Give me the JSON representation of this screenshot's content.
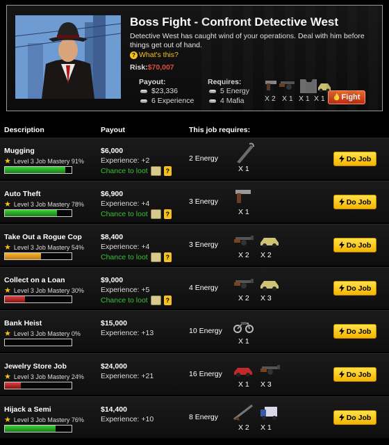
{
  "boss": {
    "title": "Boss Fight - Confront Detective West",
    "description": "Detective West has caught wind of your operations. Deal with him before things get out of hand.",
    "whats_this": "What's this?",
    "risk_label": "Risk:",
    "risk_value": "$70,007",
    "payout_header": "Payout:",
    "payout_money": "$23,336",
    "payout_experience": "6 Experience",
    "requires_header": "Requires:",
    "requires_energy": "5 Energy",
    "requires_mafia": "4 Mafia",
    "items": [
      {
        "icon": "pistol-icon",
        "qty": "X 2"
      },
      {
        "icon": "tommy-gun-icon",
        "qty": "X 1"
      },
      {
        "icon": "vest-icon",
        "qty": "X 1"
      },
      {
        "icon": "car-icon",
        "qty": "X 1"
      }
    ],
    "fight_label": "Fight"
  },
  "table_headers": {
    "description": "Description",
    "payout": "Payout",
    "requires": "This job requires:"
  },
  "jobs": [
    {
      "name": "Mugging",
      "mastery": "Level 3 Job Mastery 91%",
      "mastery_pct": 91,
      "bar_color": "green",
      "money": "$6,000",
      "experience": "Experience: +2",
      "loot": "Chance to loot",
      "energy": "2 Energy",
      "items": [
        {
          "icon": "crowbar-icon",
          "qty": "X 1"
        }
      ],
      "button": "Do Job"
    },
    {
      "name": "Auto Theft",
      "mastery": "Level 3 Job Mastery 78%",
      "mastery_pct": 78,
      "bar_color": "green",
      "money": "$6,900",
      "experience": "Experience: +4",
      "loot": "Chance to loot",
      "energy": "3 Energy",
      "items": [
        {
          "icon": "pistol-icon",
          "qty": "X 1"
        }
      ],
      "button": "Do Job"
    },
    {
      "name": "Take Out a Rogue Cop",
      "mastery": "Level 3 Job Mastery 54%",
      "mastery_pct": 54,
      "bar_color": "orange",
      "money": "$8,400",
      "experience": "Experience: +4",
      "loot": "Chance to loot",
      "energy": "3 Energy",
      "items": [
        {
          "icon": "tommy-gun-icon",
          "qty": "X 2"
        },
        {
          "icon": "car-icon",
          "qty": "X 2"
        }
      ],
      "button": "Do Job"
    },
    {
      "name": "Collect on a Loan",
      "mastery": "Level 3 Job Mastery 30%",
      "mastery_pct": 30,
      "bar_color": "red",
      "money": "$9,000",
      "experience": "Experience: +5",
      "loot": "Chance to loot",
      "energy": "4 Energy",
      "items": [
        {
          "icon": "tommy-gun-icon",
          "qty": "X 2"
        },
        {
          "icon": "car-icon",
          "qty": "X 3"
        }
      ],
      "button": "Do Job"
    },
    {
      "name": "Bank Heist",
      "mastery": "Level 3 Job Mastery 0%",
      "mastery_pct": 0,
      "bar_color": "red",
      "money": "$15,000",
      "experience": "Experience: +13",
      "loot": "",
      "energy": "10 Energy",
      "items": [
        {
          "icon": "motorcycle-icon",
          "qty": "X 1"
        }
      ],
      "button": "Do Job"
    },
    {
      "name": "Jewelry Store Job",
      "mastery": "Level 3 Job Mastery 24%",
      "mastery_pct": 24,
      "bar_color": "red",
      "money": "$24,000",
      "experience": "Experience: +21",
      "loot": "",
      "energy": "16 Energy",
      "items": [
        {
          "icon": "red-car-icon",
          "qty": "X 1"
        },
        {
          "icon": "tommy-gun-icon",
          "qty": "X 3"
        }
      ],
      "button": "Do Job"
    },
    {
      "name": "Hijack a Semi",
      "mastery": "Level 3 Job Mastery 76%",
      "mastery_pct": 76,
      "bar_color": "green",
      "money": "$14,400",
      "experience": "Experience: +10",
      "loot": "",
      "energy": "8 Energy",
      "items": [
        {
          "icon": "shotgun-icon",
          "qty": "X 2"
        },
        {
          "icon": "truck-icon",
          "qty": "X 1"
        }
      ],
      "button": "Do Job"
    }
  ]
}
